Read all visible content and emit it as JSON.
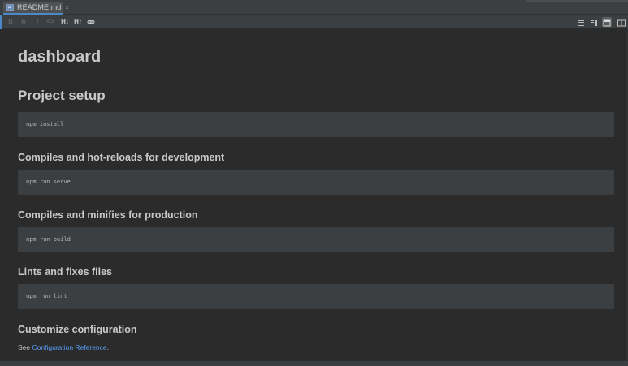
{
  "tab": {
    "label": "README.md",
    "close": "×",
    "icon": "markdown-file-icon"
  },
  "toolbar": {
    "buttons": [
      {
        "name": "bold-icon",
        "text": "B"
      },
      {
        "name": "strikethrough-icon",
        "text": "S"
      },
      {
        "name": "italic-icon",
        "text": "I"
      },
      {
        "name": "code-icon",
        "text": "<>"
      },
      {
        "name": "header-down-icon",
        "text": "H↓"
      },
      {
        "name": "header-up-icon",
        "text": "H↑"
      },
      {
        "name": "link-icon",
        "text": ""
      }
    ],
    "view_modes": [
      "editor-only-icon",
      "split-icon",
      "preview-only-icon",
      "side-by-side-icon"
    ],
    "selected_view": "preview-only-icon"
  },
  "doc": {
    "title": "dashboard",
    "setup_heading": "Project setup",
    "install_cmd": "npm install",
    "dev_heading": "Compiles and hot-reloads for development",
    "serve_cmd": "npm run serve",
    "prod_heading": "Compiles and minifies for production",
    "build_cmd": "npm run build",
    "lint_heading": "Lints and fixes files",
    "lint_cmd": "npm run lint",
    "config_heading": "Customize configuration",
    "config_prefix": "See ",
    "config_link": "Configuration Reference",
    "config_suffix": "."
  },
  "colors": {
    "background": "#2b2b2b",
    "code_bg": "#3c3f41",
    "link": "#589df6",
    "accent": "#4a88c7"
  }
}
